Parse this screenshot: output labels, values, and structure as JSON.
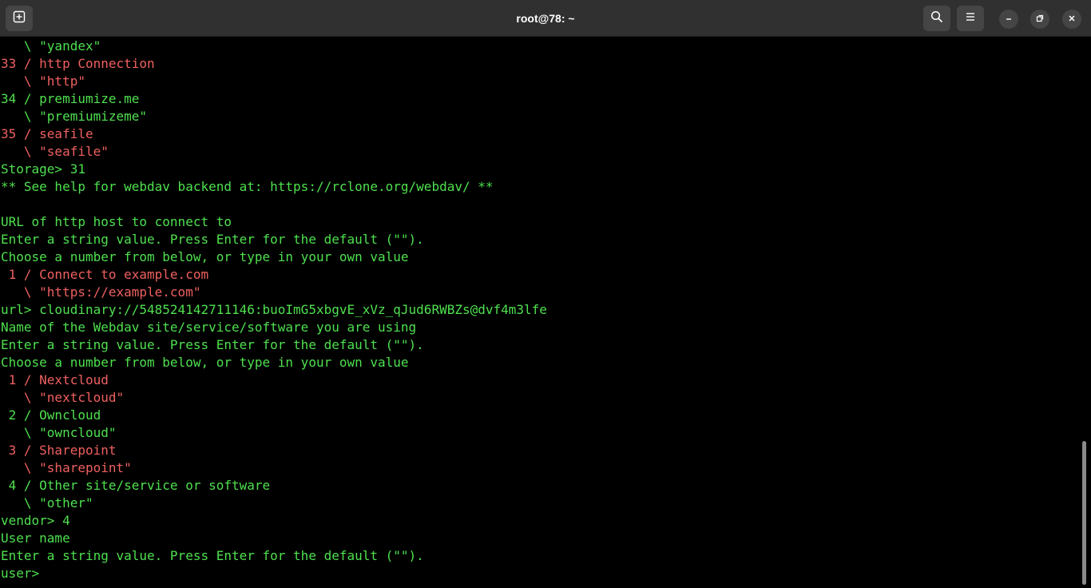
{
  "window": {
    "title": "root@78: ~"
  },
  "icons": {
    "new_tab": "new-tab-icon",
    "search": "search-icon",
    "menu": "hamburger-menu-icon",
    "minimize": "minimize-icon",
    "maximize": "maximize-icon",
    "close": "close-icon"
  },
  "colors": {
    "prompt_green": "#4ee04e",
    "option_red": "#ef6060",
    "titlebar": "#303030",
    "background": "#000000"
  },
  "terminal": {
    "lines": [
      {
        "color": "g",
        "text": "   \\ \"yandex\""
      },
      {
        "color": "r",
        "text": "33 / http Connection"
      },
      {
        "color": "r",
        "text": "   \\ \"http\""
      },
      {
        "color": "g",
        "text": "34 / premiumize.me"
      },
      {
        "color": "g",
        "text": "   \\ \"premiumizeme\""
      },
      {
        "color": "r",
        "text": "35 / seafile"
      },
      {
        "color": "r",
        "text": "   \\ \"seafile\""
      },
      {
        "color": "g",
        "text": "Storage> 31"
      },
      {
        "color": "g",
        "text": "** See help for webdav backend at: https://rclone.org/webdav/ **"
      },
      {
        "color": "g",
        "text": ""
      },
      {
        "color": "g",
        "text": "URL of http host to connect to"
      },
      {
        "color": "g",
        "text": "Enter a string value. Press Enter for the default (\"\")."
      },
      {
        "color": "g",
        "text": "Choose a number from below, or type in your own value"
      },
      {
        "color": "r",
        "text": " 1 / Connect to example.com"
      },
      {
        "color": "r",
        "text": "   \\ \"https://example.com\""
      },
      {
        "color": "g",
        "text": "url> cloudinary://548524142711146:buoImG5xbgvE_xVz_qJud6RWBZs@dvf4m3lfe"
      },
      {
        "color": "g",
        "text": "Name of the Webdav site/service/software you are using"
      },
      {
        "color": "g",
        "text": "Enter a string value. Press Enter for the default (\"\")."
      },
      {
        "color": "g",
        "text": "Choose a number from below, or type in your own value"
      },
      {
        "color": "r",
        "text": " 1 / Nextcloud"
      },
      {
        "color": "r",
        "text": "   \\ \"nextcloud\""
      },
      {
        "color": "g",
        "text": " 2 / Owncloud"
      },
      {
        "color": "g",
        "text": "   \\ \"owncloud\""
      },
      {
        "color": "r",
        "text": " 3 / Sharepoint"
      },
      {
        "color": "r",
        "text": "   \\ \"sharepoint\""
      },
      {
        "color": "g",
        "text": " 4 / Other site/service or software"
      },
      {
        "color": "g",
        "text": "   \\ \"other\""
      },
      {
        "color": "g",
        "text": "vendor> 4"
      },
      {
        "color": "g",
        "text": "User name"
      },
      {
        "color": "g",
        "text": "Enter a string value. Press Enter for the default (\"\")."
      },
      {
        "color": "g",
        "text": "user>"
      }
    ]
  }
}
